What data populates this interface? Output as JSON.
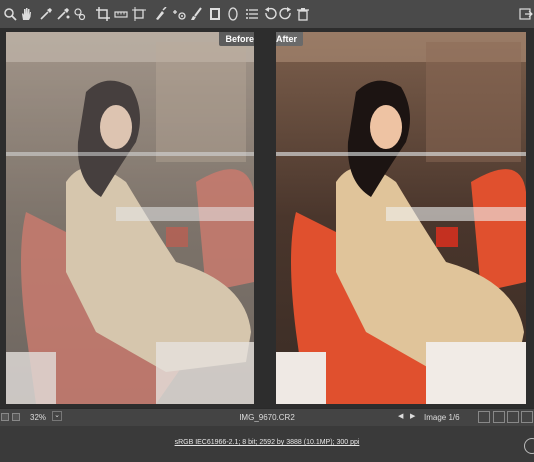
{
  "toolbar": {
    "tools": [
      {
        "name": "zoom-icon"
      },
      {
        "name": "hand-icon"
      },
      {
        "name": "white-balance-icon"
      },
      {
        "name": "color-sampler-icon"
      },
      {
        "name": "targeted-adjustment-icon"
      },
      {
        "name": "crop-icon"
      },
      {
        "name": "straighten-icon"
      },
      {
        "name": "transform-icon"
      },
      {
        "name": "spot-removal-icon"
      },
      {
        "name": "red-eye-icon"
      },
      {
        "name": "adjustment-brush-icon"
      },
      {
        "name": "graduated-filter-icon"
      },
      {
        "name": "radial-filter-icon"
      },
      {
        "name": "preferences-icon"
      },
      {
        "name": "rotate-left-icon"
      },
      {
        "name": "rotate-right-icon"
      },
      {
        "name": "trash-icon"
      }
    ]
  },
  "panes": {
    "before_label": "Before",
    "after_label": "After"
  },
  "status": {
    "zoom": "32%",
    "filename": "IMG_9670.CR2",
    "image_counter": "Image 1/6"
  },
  "info": {
    "workflow": "sRGB IEC61966-2.1; 8 bit; 2592 by 3888 (10.1MP); 300 ppi"
  },
  "colors": {
    "toolbar_bg": "#4a4a4a",
    "canvas_bg": "#2d2d2d",
    "chair_before": "#c96a5a",
    "chair_after": "#e0502e"
  }
}
